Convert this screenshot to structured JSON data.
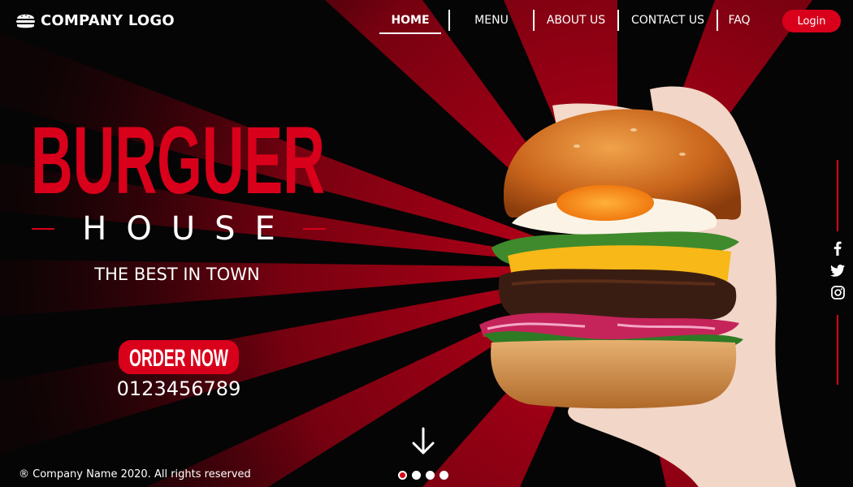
{
  "header": {
    "logo_text": "COMPANY LOGO",
    "logo_icon": "burger-icon",
    "nav": [
      {
        "label": "HOME",
        "active": true
      },
      {
        "label": "MENU",
        "active": false
      },
      {
        "label": "ABOUT US",
        "active": false
      },
      {
        "label": "CONTACT US",
        "active": false
      },
      {
        "label": "FAQ",
        "active": false
      }
    ],
    "login_label": "Login"
  },
  "hero": {
    "title": "BURGUER",
    "subtitle": "HOUSE",
    "tagline": "THE BEST IN TOWN",
    "order_label": "ORDER NOW",
    "phone": "0123456789"
  },
  "social": {
    "icons": [
      "facebook-icon",
      "twitter-icon",
      "instagram-icon"
    ]
  },
  "carousel": {
    "dots": 4,
    "active_index": 0
  },
  "footer": {
    "copyright": "® Company Name 2020. All rights reserved"
  },
  "colors": {
    "accent": "#d9001b",
    "background": "#000000",
    "text": "#ffffff"
  }
}
